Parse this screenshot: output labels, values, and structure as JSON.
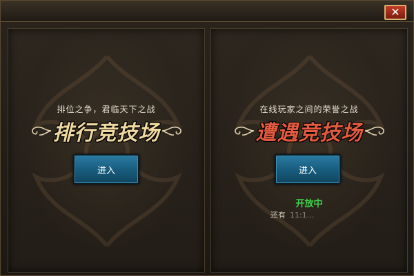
{
  "window": {
    "close_label": "✕"
  },
  "panels": [
    {
      "subtitle": "排位之争，君临天下之战",
      "title": "排行竞技场",
      "enter_label": "进入"
    },
    {
      "subtitle": "在线玩家之间的荣誉之战",
      "title": "遭遇竞技场",
      "enter_label": "进入",
      "status": "开放中",
      "remaining_label": "还有",
      "remaining_time": "11:1..."
    }
  ],
  "colors": {
    "gold_title": "#f0d9a0",
    "red_title": "#e35a3f",
    "status_green": "#3fd24a",
    "button_blue": "#175b7c"
  }
}
